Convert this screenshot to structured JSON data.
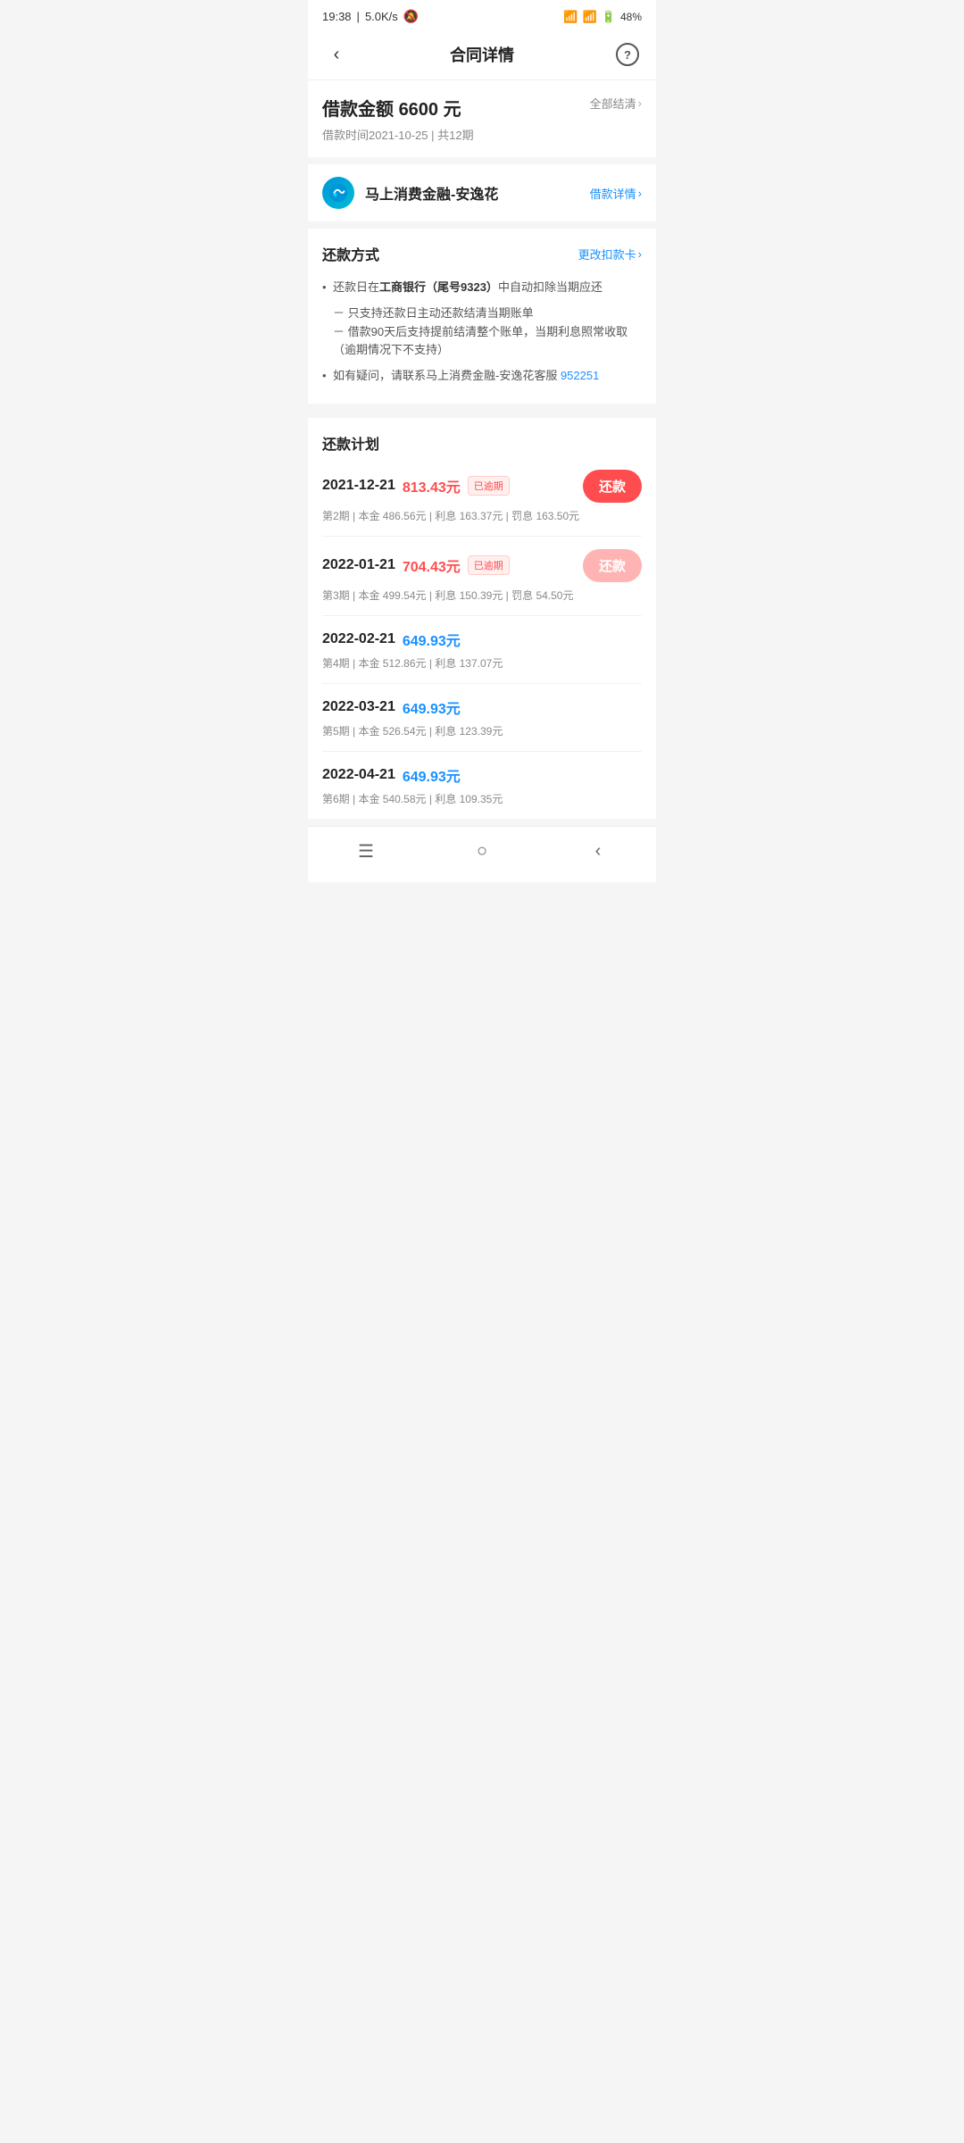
{
  "statusBar": {
    "time": "19:38",
    "network": "5.0K/s",
    "battery": "48%"
  },
  "navBar": {
    "title": "合同详情",
    "backLabel": "‹",
    "helpLabel": "?"
  },
  "loanInfo": {
    "label": "借款金额",
    "amount": "6600 元",
    "date": "借款时间2021-10-25",
    "periods": "共12期",
    "settleLabel": "全部结清"
  },
  "bank": {
    "name": "马上消费金融-安逸花",
    "detailLabel": "借款详情"
  },
  "repayMethod": {
    "title": "还款方式",
    "changeLabel": "更改扣款卡",
    "notes": [
      "还款日在工商银行（尾号9323）中自动扣除当期应还",
      "－ 只支持还款日主动还款结清当期账单\n－ 借款90天后支持提前结清整个账单，当期利息照常收取（逾期情况下不支持）",
      "如有疑问，请联系马上消费金融-安逸花客服 952251"
    ],
    "bankHighlight": "工商银行（尾号9323）",
    "phone": "952251"
  },
  "repaymentPlan": {
    "title": "还款计划",
    "items": [
      {
        "date": "2021-12-21",
        "amount": "813.43元",
        "status": "已逾期",
        "overdue": true,
        "buttonLabel": "还款",
        "buttonActive": true,
        "detail": "第2期 | 本金 486.56元 | 利息 163.37元 | 罚息 163.50元"
      },
      {
        "date": "2022-01-21",
        "amount": "704.43元",
        "status": "已逾期",
        "overdue": true,
        "buttonLabel": "还款",
        "buttonActive": false,
        "detail": "第3期 | 本金 499.54元 | 利息 150.39元 | 罚息 54.50元"
      },
      {
        "date": "2022-02-21",
        "amount": "649.93元",
        "status": "",
        "overdue": false,
        "buttonLabel": "",
        "buttonActive": false,
        "detail": "第4期 | 本金 512.86元 | 利息 137.07元"
      },
      {
        "date": "2022-03-21",
        "amount": "649.93元",
        "status": "",
        "overdue": false,
        "buttonLabel": "",
        "buttonActive": false,
        "detail": "第5期 | 本金 526.54元 | 利息 123.39元"
      },
      {
        "date": "2022-04-21",
        "amount": "649.93元",
        "status": "",
        "overdue": false,
        "buttonLabel": "",
        "buttonActive": false,
        "detail": "第6期 | 本金 540.58元 | 利息 109.35元"
      }
    ]
  },
  "bottomNav": {
    "menu": "☰",
    "home": "○",
    "back": "‹"
  }
}
